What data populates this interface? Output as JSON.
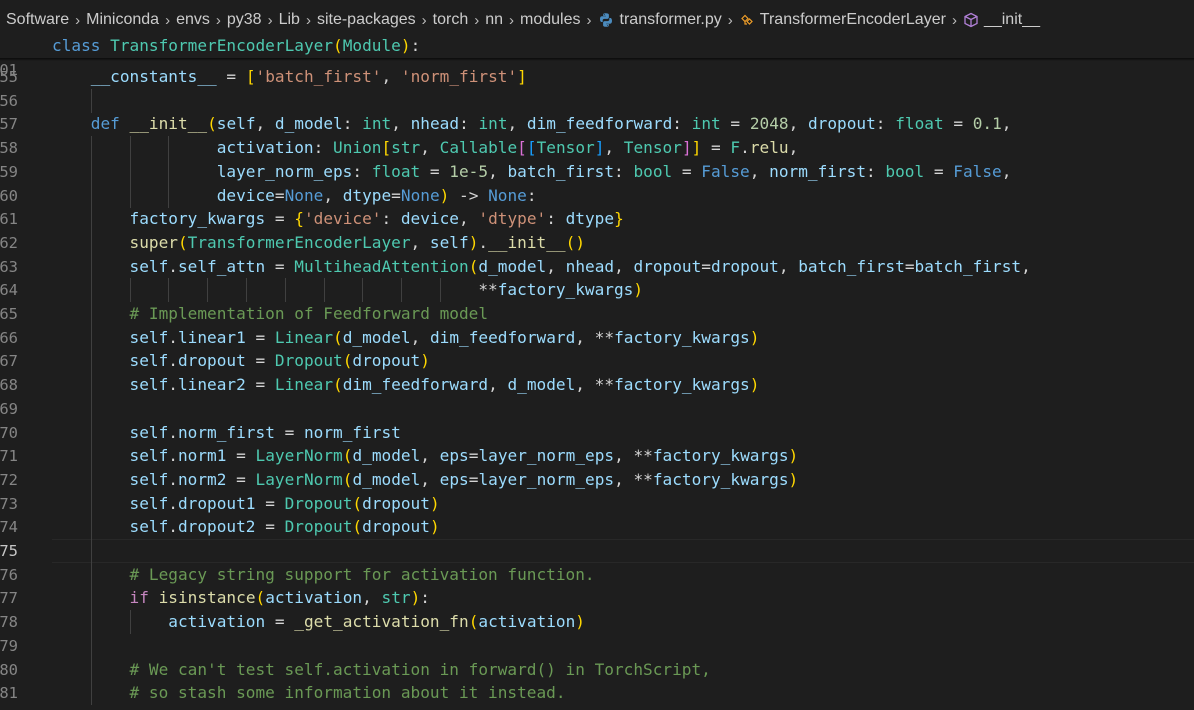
{
  "breadcrumb": {
    "items": [
      "Software",
      "Miniconda",
      "envs",
      "py38",
      "Lib",
      "site-packages",
      "torch",
      "nn",
      "modules",
      "transformer.py",
      "TransformerEncoderLayer",
      "__init__"
    ]
  },
  "sticky": {
    "line_number": "01",
    "text": "class TransformerEncoderLayer(Module):"
  },
  "editor": {
    "active_line": "75",
    "line_numbers": [
      "55",
      "56",
      "57",
      "58",
      "59",
      "60",
      "61",
      "62",
      "63",
      "64",
      "65",
      "66",
      "67",
      "68",
      "69",
      "70",
      "71",
      "72",
      "73",
      "74",
      "75",
      "76",
      "77",
      "78",
      "79",
      "80",
      "81"
    ],
    "lines": [
      "    __constants__ = ['batch_first', 'norm_first']",
      "",
      "    def __init__(self, d_model: int, nhead: int, dim_feedforward: int = 2048, dropout: float = 0.1,",
      "                 activation: Union[str, Callable[[Tensor], Tensor]] = F.relu,",
      "                 layer_norm_eps: float = 1e-5, batch_first: bool = False, norm_first: bool = False,",
      "                 device=None, dtype=None) -> None:",
      "        factory_kwargs = {'device': device, 'dtype': dtype}",
      "        super(TransformerEncoderLayer, self).__init__()",
      "        self.self_attn = MultiheadAttention(d_model, nhead, dropout=dropout, batch_first=batch_first,",
      "                                            **factory_kwargs)",
      "        # Implementation of Feedforward model",
      "        self.linear1 = Linear(d_model, dim_feedforward, **factory_kwargs)",
      "        self.dropout = Dropout(dropout)",
      "        self.linear2 = Linear(dim_feedforward, d_model, **factory_kwargs)",
      "",
      "        self.norm_first = norm_first",
      "        self.norm1 = LayerNorm(d_model, eps=layer_norm_eps, **factory_kwargs)",
      "        self.norm2 = LayerNorm(d_model, eps=layer_norm_eps, **factory_kwargs)",
      "        self.dropout1 = Dropout(dropout)",
      "        self.dropout2 = Dropout(dropout)",
      "",
      "        # Legacy string support for activation function.",
      "        if isinstance(activation, str):",
      "            activation = _get_activation_fn(activation)",
      "",
      "        # We can't test self.activation in forward() in TorchScript,",
      "        # so stash some information about it instead."
    ]
  },
  "colors": {
    "background": "#1e1e1e",
    "keyword": "#569cd6",
    "class": "#4ec9b0",
    "function": "#dcdcaa",
    "variable": "#9cdcfe",
    "string": "#ce9178",
    "number": "#b5cea8",
    "comment": "#6a9955",
    "bracket_level1": "#ffd700",
    "bracket_level2": "#da70d6",
    "bracket_level3": "#179fff"
  },
  "icons": {
    "file_icon": "python-icon",
    "symbol_icon": "cube-method-icon"
  }
}
